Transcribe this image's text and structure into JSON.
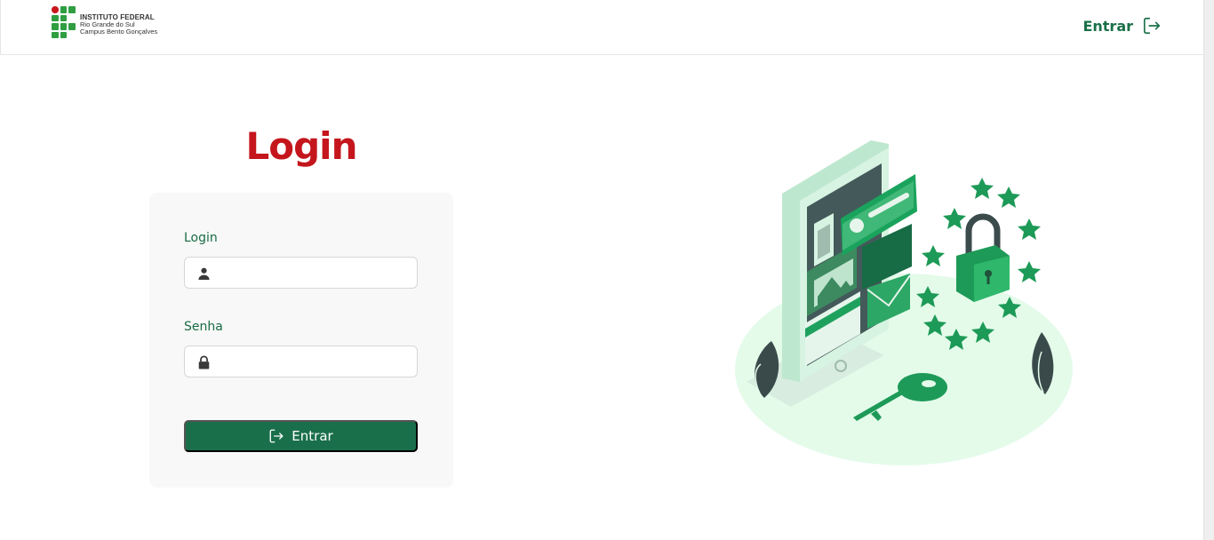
{
  "header": {
    "logo": {
      "line1": "INSTITUTO FEDERAL",
      "line2": "Rio Grande do Sul",
      "line3": "Campus Bento Gonçalves"
    },
    "login_link": {
      "label": "Entrar",
      "icon": "sign-in-icon"
    }
  },
  "login_form": {
    "title": "Login",
    "username": {
      "label": "Login",
      "value": "",
      "placeholder": "",
      "icon": "user-icon"
    },
    "password": {
      "label": "Senha",
      "value": "",
      "placeholder": "",
      "icon": "lock-icon"
    },
    "submit": {
      "label": "Entrar",
      "icon": "sign-in-icon"
    }
  },
  "illustration": {
    "description_icon": "secure-login-illustration"
  },
  "colors": {
    "brand_green": "#1a6f4b",
    "title_red": "#c4161c",
    "logo_green": "#2f9e41",
    "logo_red": "#c8191e"
  }
}
